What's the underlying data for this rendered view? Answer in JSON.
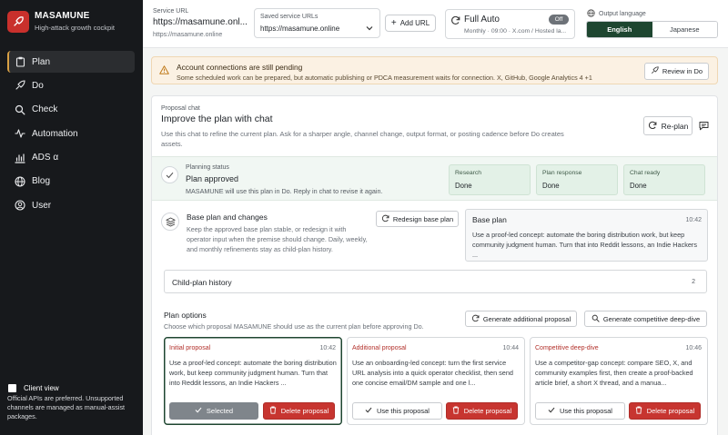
{
  "brand": {
    "name": "MASAMUNE",
    "tagline": "High-attack growth cockpit"
  },
  "nav": [
    {
      "label": "Plan",
      "icon": "clipboard-icon",
      "active": true
    },
    {
      "label": "Do",
      "icon": "rocket-icon",
      "active": false
    },
    {
      "label": "Check",
      "icon": "search-icon",
      "active": false
    },
    {
      "label": "Automation",
      "icon": "pulse-icon",
      "active": false
    },
    {
      "label": "ADS α",
      "icon": "chart-icon",
      "active": false
    },
    {
      "label": "Blog",
      "icon": "globe-icon",
      "active": false
    },
    {
      "label": "User",
      "icon": "user-icon",
      "active": false
    }
  ],
  "sidebar_footer": {
    "client_view_label": "Client view",
    "note": "Official APIs are preferred. Unsupported channels are managed as manual-assist packages."
  },
  "topbar": {
    "service_url_label": "Service URL",
    "service_url_value": "https://masamune.onl...",
    "service_url_sub": "https://masamune.online",
    "saved_label": "Saved service URLs",
    "saved_value": "https://masamune.online",
    "add_url_label": "Add URL",
    "auto_title": "Full Auto",
    "auto_sub": "Monthly · 09:00 · X.com / Hosted la...",
    "auto_toggle": "Off",
    "lang_label": "Output language",
    "lang_options": [
      "English",
      "Japanese"
    ],
    "lang_selected": "English"
  },
  "alert": {
    "title": "Account connections are still pending",
    "text": "Some scheduled work can be prepared, but automatic publishing or PDCA measurement waits for connection. X, GitHub, Google Analytics 4 +1",
    "button": "Review in Do"
  },
  "chat": {
    "eyebrow": "Proposal chat",
    "title": "Improve the plan with chat",
    "description": "Use this chat to refine the current plan. Ask for a sharper angle, channel change, output format, or posting cadence before Do creates assets.",
    "replan_label": "Re-plan"
  },
  "status": {
    "label": "Planning status",
    "title": "Plan approved",
    "description": "MASAMUNE will use this plan in Do. Reply in chat to revise it again.",
    "chips": [
      {
        "label": "Research",
        "value": "Done"
      },
      {
        "label": "Plan response",
        "value": "Done"
      },
      {
        "label": "Chat ready",
        "value": "Done"
      }
    ]
  },
  "base": {
    "title": "Base plan and changes",
    "description": "Keep the approved base plan stable, or redesign it with operator input when the premise should change. Daily, weekly, and monthly refinements stay as child-plan history.",
    "redesign_label": "Redesign base plan",
    "box_title": "Base plan",
    "box_time": "10:42",
    "box_text": "Use a proof-led concept: automate the boring distribution work, but keep community judgment human. Turn that into Reddit lessons, an Indie Hackers ..."
  },
  "history": {
    "label": "Child-plan history",
    "count": "2"
  },
  "options": {
    "title": "Plan options",
    "description": "Choose which proposal MASAMUNE should use as the current plan before approving Do.",
    "gen_additional": "Generate additional proposal",
    "gen_competitive": "Generate competitive deep-dive",
    "proposals": [
      {
        "tag": "Initial proposal",
        "time": "10:42",
        "text": "Use a proof-led concept: automate the boring distribution work, but keep community judgment human. Turn that into Reddit lessons, an Indie Hackers ...",
        "primary": "Selected",
        "delete": "Delete proposal"
      },
      {
        "tag": "Additional proposal",
        "time": "10:44",
        "text": "Use an onboarding-led concept: turn the first service URL analysis into a quick operator checklist, then send one concise email/DM sample and one l...",
        "primary": "Use this proposal",
        "delete": "Delete proposal"
      },
      {
        "tag": "Competitive deep-dive",
        "time": "10:46",
        "text": "Use a competitor-gap concept: compare SEO, X, and community examples first, then create a proof-backed article brief, a short X thread, and a manua...",
        "primary": "Use this proposal",
        "delete": "Delete proposal"
      }
    ]
  },
  "colors": {
    "accent_green": "#1e4630",
    "danger": "#c73530",
    "sidebar": "#17191c",
    "nav_active_marker": "#d8a044"
  }
}
